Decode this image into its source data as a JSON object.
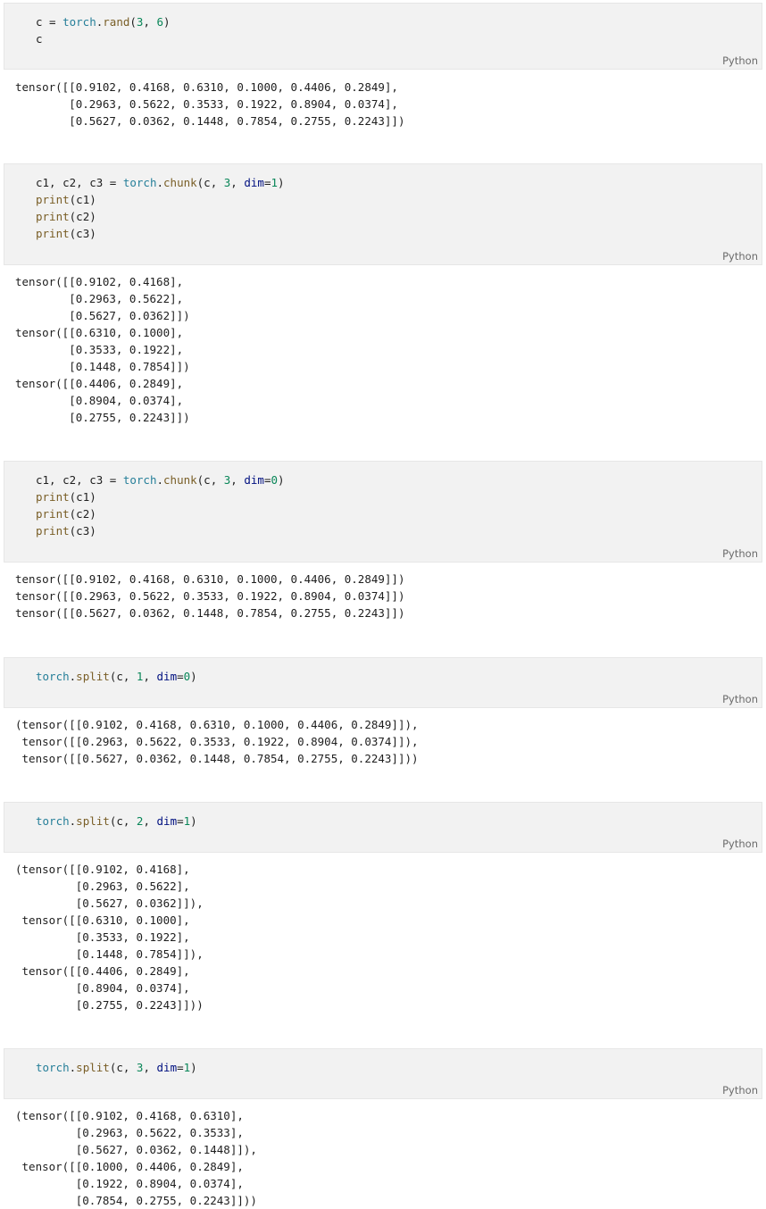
{
  "cells": [
    {
      "id": "cell1",
      "language": "Python",
      "code": [
        "c = torch.rand(3, 6)",
        "c"
      ],
      "output": [
        "tensor([[0.9102, 0.4168, 0.6310, 0.1000, 0.4406, 0.2849],",
        "        [0.2963, 0.5622, 0.3533, 0.1922, 0.8904, 0.0374],",
        "        [0.5627, 0.0362, 0.1448, 0.7854, 0.2755, 0.2243]])"
      ]
    },
    {
      "id": "cell2",
      "language": "Python",
      "code": [
        "c1, c2, c3 = torch.chunk(c, 3, dim=1)",
        "print(c1)",
        "print(c2)",
        "print(c3)"
      ],
      "output": [
        "tensor([[0.9102, 0.4168],",
        "        [0.2963, 0.5622],",
        "        [0.5627, 0.0362]])",
        "tensor([[0.6310, 0.1000],",
        "        [0.3533, 0.1922],",
        "        [0.1448, 0.7854]])",
        "tensor([[0.4406, 0.2849],",
        "        [0.8904, 0.0374],",
        "        [0.2755, 0.2243]])"
      ]
    },
    {
      "id": "cell3",
      "language": "Python",
      "code": [
        "c1, c2, c3 = torch.chunk(c, 3, dim=0)",
        "print(c1)",
        "print(c2)",
        "print(c3)"
      ],
      "output": [
        "tensor([[0.9102, 0.4168, 0.6310, 0.1000, 0.4406, 0.2849]])",
        "tensor([[0.2963, 0.5622, 0.3533, 0.1922, 0.8904, 0.0374]])",
        "tensor([[0.5627, 0.0362, 0.1448, 0.7854, 0.2755, 0.2243]])"
      ]
    },
    {
      "id": "cell4",
      "language": "Python",
      "code": [
        "torch.split(c, 1, dim=0)"
      ],
      "output": [
        "(tensor([[0.9102, 0.4168, 0.6310, 0.1000, 0.4406, 0.2849]]),",
        " tensor([[0.2963, 0.5622, 0.3533, 0.1922, 0.8904, 0.0374]]),",
        " tensor([[0.5627, 0.0362, 0.1448, 0.7854, 0.2755, 0.2243]]))"
      ]
    },
    {
      "id": "cell5",
      "language": "Python",
      "code": [
        "torch.split(c, 2, dim=1)"
      ],
      "output": [
        "(tensor([[0.9102, 0.4168],",
        "         [0.2963, 0.5622],",
        "         [0.5627, 0.0362]]),",
        " tensor([[0.6310, 0.1000],",
        "         [0.3533, 0.1922],",
        "         [0.1448, 0.7854]]),",
        " tensor([[0.4406, 0.2849],",
        "         [0.8904, 0.0374],",
        "         [0.2755, 0.2243]]))"
      ]
    },
    {
      "id": "cell6",
      "language": "Python",
      "code": [
        "torch.split(c, 3, dim=1)"
      ],
      "output": [
        "(tensor([[0.9102, 0.4168, 0.6310],",
        "         [0.2963, 0.5622, 0.3533],",
        "         [0.5627, 0.0362, 0.1448]]),",
        " tensor([[0.1000, 0.4406, 0.2849],",
        "         [0.1922, 0.8904, 0.0374],",
        "         [0.7854, 0.2755, 0.2243]]))"
      ]
    }
  ],
  "colors": {
    "code_bg": "#f2f2f2",
    "function": "#267f99",
    "number": "#098658",
    "keyword_arg": "#001080",
    "builtin": "#795e26"
  }
}
